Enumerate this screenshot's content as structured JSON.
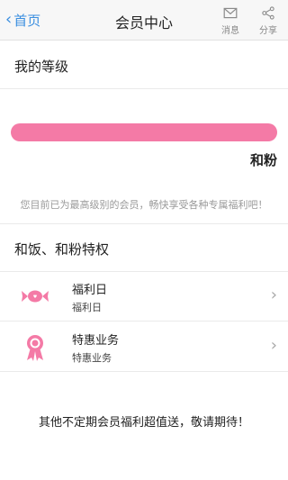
{
  "header": {
    "back_label": "首页",
    "title": "会员中心",
    "message_label": "消息",
    "share_label": "分享"
  },
  "my_level": {
    "title": "我的等级",
    "progress": 1.0,
    "level_name": "和粉"
  },
  "note": "您目前已为最高级别的会员，畅快享受各种专属福利吧！",
  "privileges": {
    "title": "和饭、和粉特权",
    "items": [
      {
        "title": "福利日",
        "subtitle": "福利日",
        "icon": "candy-icon"
      },
      {
        "title": "特惠业务",
        "subtitle": "特惠业务",
        "icon": "rosette-icon"
      }
    ]
  },
  "footer_text": "其他不定期会员福利超值送，敬请期待！",
  "colors": {
    "accent_blue": "#3b8fe0",
    "level_pink": "#f47aa6"
  }
}
